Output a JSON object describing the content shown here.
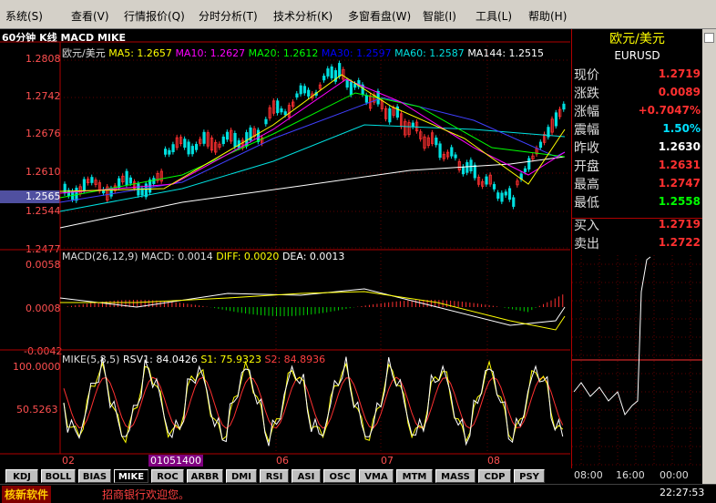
{
  "menu": [
    "系统(S)",
    "查看(V)",
    "行情报价(Q)",
    "分时分析(T)",
    "技术分析(K)",
    "多窗看盘(W)",
    "智能(I)",
    "工具(L)",
    "帮助(H)"
  ],
  "chart_title": "60分钟 K线 MACD MIKE",
  "price_panel": {
    "symbol": "欧元/美元",
    "ma": [
      {
        "label": "MA5: 1.2657",
        "color": "#ffff00"
      },
      {
        "label": "MA10: 1.2627",
        "color": "#ff00ff"
      },
      {
        "label": "MA20: 1.2612",
        "color": "#00ff00"
      },
      {
        "label": "MA30: 1.2597",
        "color": "#0000ff"
      },
      {
        "label": "MA60: 1.2587",
        "color": "#00e0e0"
      },
      {
        "label": "MA144: 1.2515",
        "color": "#ffffff"
      }
    ],
    "y_labels": [
      "1.2808",
      "1.2742",
      "1.2676",
      "1.2610",
      "1.2544",
      "1.2477"
    ],
    "cursor_price": "1.2565"
  },
  "macd_panel": {
    "title": "MACD(26,12,9)",
    "macd": "MACD: 0.0014",
    "diff": "DIFF: 0.0020",
    "dea": "DEA: 0.0013",
    "y_labels": [
      "0.0058",
      "0.0008",
      "-0.0042"
    ]
  },
  "mike_panel": {
    "title": "MIKE(5,8,5)",
    "rsv": "RSV1: 84.0426",
    "s1": "S1: 75.9323",
    "s2": "S2: 84.8936",
    "y_labels": [
      "100.0000",
      "50.5263"
    ]
  },
  "x_axis": {
    "labels": [
      "02",
      "01051400",
      "06",
      "07",
      "08"
    ]
  },
  "quote": {
    "name": "欧元/美元",
    "code": "EURUSD",
    "rows": [
      {
        "label": "现价",
        "value": "1.2719",
        "color": "#ff3030"
      },
      {
        "label": "涨跌",
        "value": "0.0089",
        "color": "#ff3030"
      },
      {
        "label": "涨幅",
        "value": "+0.7047%",
        "color": "#ff3030"
      },
      {
        "label": "震幅",
        "value": "1.50%",
        "color": "#00e0ff"
      },
      {
        "label": "昨收",
        "value": "1.2630",
        "color": "#ffffff"
      },
      {
        "label": "开盘",
        "value": "1.2631",
        "color": "#ff3030"
      },
      {
        "label": "最高",
        "value": "1.2747",
        "color": "#ff3030"
      },
      {
        "label": "最低",
        "value": "1.2558",
        "color": "#00ff00"
      },
      {
        "label": "买入",
        "value": "1.2719",
        "color": "#ff3030"
      },
      {
        "label": "卖出",
        "value": "1.2722",
        "color": "#ff3030"
      }
    ],
    "mini_times": [
      "08:00",
      "16:00",
      "00:00"
    ]
  },
  "tabs": [
    "KDJ",
    "BOLL",
    "BIAS",
    "MIKE",
    "ROC",
    "ARBR",
    "DMI",
    "RSI",
    "ASI",
    "OSC",
    "VMA",
    "MTM",
    "MASS",
    "CDP",
    "PSY"
  ],
  "active_tab": "MIKE",
  "status": {
    "logo": "核新软件",
    "message": "招商银行欢迎您。",
    "time": "22:27:53"
  }
}
